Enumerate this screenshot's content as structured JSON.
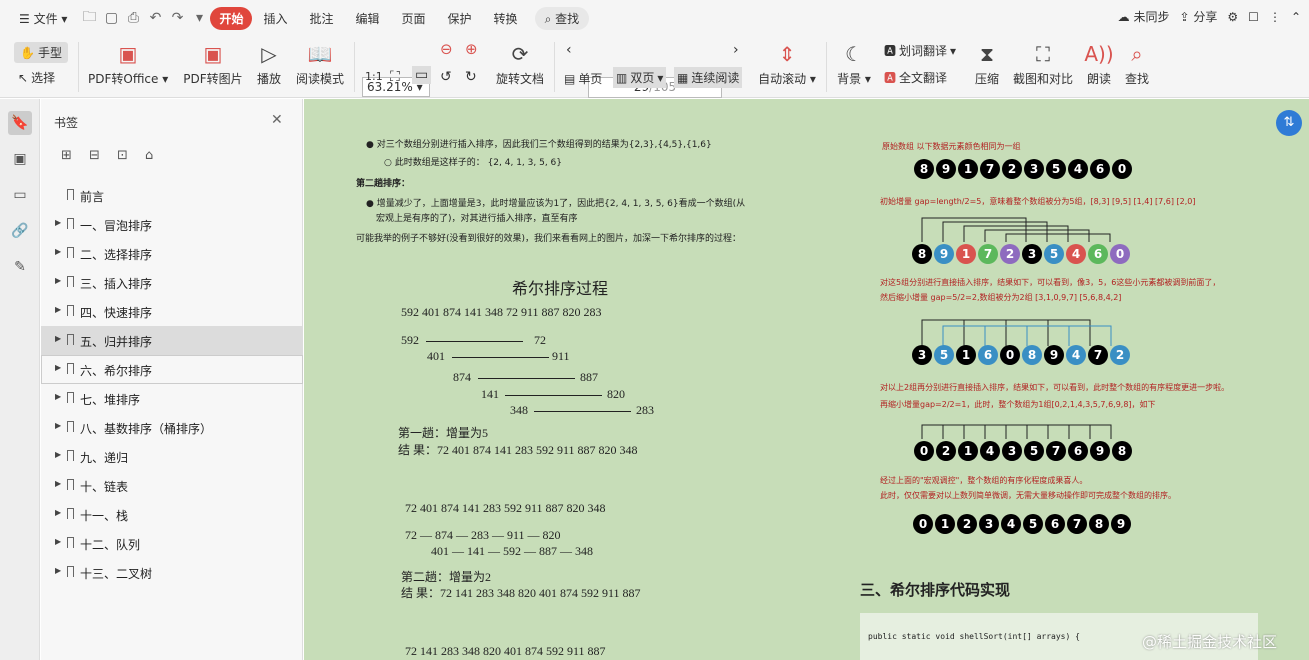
{
  "menu": {
    "hamburger": "☰",
    "file": "文件",
    "start": "开始",
    "insert": "插入",
    "comment": "批注",
    "edit": "编辑",
    "page": "页面",
    "protect": "保护",
    "convert": "转换",
    "search": "查找",
    "unsync": "未同步",
    "share": "分享"
  },
  "toolbar": {
    "hand": "手型",
    "select": "选择",
    "pdf_office": "PDF转Office",
    "pdf_image": "PDF转图片",
    "play": "播放",
    "read_mode": "阅读模式",
    "zoom": "63.21%",
    "rotate_doc": "旋转文档",
    "page_current": "29",
    "page_total": "/105",
    "single": "单页",
    "double": "双页",
    "continuous": "连续阅读",
    "auto_scroll": "自动滚动",
    "background": "背景",
    "word_translate": "划词翻译",
    "full_translate": "全文翻译",
    "compress": "压缩",
    "screenshot_compare": "截图和对比",
    "read_aloud": "朗读",
    "find": "查找"
  },
  "panel": {
    "title": "书签",
    "items": [
      {
        "label": "前言",
        "expand": false
      },
      {
        "label": "一、冒泡排序",
        "expand": true
      },
      {
        "label": "二、选择排序",
        "expand": true
      },
      {
        "label": "三、插入排序",
        "expand": true
      },
      {
        "label": "四、快速排序",
        "expand": true
      },
      {
        "label": "五、归并排序",
        "expand": true
      },
      {
        "label": "六、希尔排序",
        "expand": true
      },
      {
        "label": "七、堆排序",
        "expand": true
      },
      {
        "label": "八、基数排序（桶排序）",
        "expand": true
      },
      {
        "label": "九、递归",
        "expand": true
      },
      {
        "label": "十、链表",
        "expand": true
      },
      {
        "label": "十一、栈",
        "expand": true
      },
      {
        "label": "十二、队列",
        "expand": true
      },
      {
        "label": "十三、二叉树",
        "expand": true
      }
    ]
  },
  "doc": {
    "p1": "对三个数组分别进行插入排序，因此我们三个数组得到的结果为{2,3},{4,5},{1,6}",
    "p2": "此时数组是这样子的：  {2, 4, 1, 3, 5, 6}",
    "p3": "第二趟排序：",
    "p4": "增量减少了，上面增量是3，此时增量应该为1了，因此把{2, 4, 1, 3, 5, 6}看成一个数组(从",
    "p5": "宏观上是有序的了)，对其进行插入排序，直至有序",
    "p6": "可能我举的例子不够好(没看到很好的效果)，我们来看看网上的图片，加深一下希尔排序的过程：",
    "shell_title": "希尔排序过程",
    "seq0": "592  401  874  141  348  72  911  887  820  283",
    "g1": [
      "592",
      "72",
      "401",
      "911",
      "874",
      "887",
      "141",
      "820",
      "348",
      "283"
    ],
    "pass1_label": "第一趟：增量为5",
    "pass1_result": "结    果：72  401  874  141  283  592  911  887  820  348",
    "seq1": "72  401  874  141  283  592  911  887  820  348",
    "g2a": "72    —  874   —   283   —   911   —   820",
    "g2b": "401  —  141   —   592   —   887   —   348",
    "pass2_label": "第二趟：增量为2",
    "pass2_result": "结    果：72  141  283  348  820  401  874  592  911  887",
    "seq2": "72  141  283  348  820  401  874  592  911  887",
    "r_orig": "原始数组    以下数据元素颜色相同为一组",
    "r_init": "初始增量 gap=length/2=5，意味着整个数组被分为5组，[8,3] [9,5] [1,4] [7,6] [2,0]",
    "r_a": "对这5组分别进行直接插入排序，结果如下，可以看到，像3，5，6这些小元素都被调到前面了，",
    "r_b": "然后缩小增量 gap=5/2=2,数组被分为2组 [3,1,0,9,7] [5,6,8,4,2]",
    "r_c": "对以上2组再分别进行直接插入排序，结果如下，可以看到，此时整个数组的有序程度更进一步啦。",
    "r_d": "再缩小增量gap=2/2=1，此时，整个数组为1组[0,2,1,4,3,5,7,6,9,8]，如下",
    "r_e": "经过上面的\"宏观调控\"，整个数组的有序化程度成果喜人。",
    "r_f": "此时，仅仅需要对以上数列简单微调，无需大量移动操作即可完成整个数组的排序。",
    "arr0": [
      "8",
      "9",
      "1",
      "7",
      "2",
      "3",
      "5",
      "4",
      "6",
      "0"
    ],
    "arr1": [
      "8",
      "9",
      "1",
      "7",
      "2",
      "3",
      "5",
      "4",
      "6",
      "0"
    ],
    "arr1_colors": [
      "#000",
      "#3a8fc4",
      "#d9534f",
      "#5cb85c",
      "#8e6bbf",
      "#000",
      "#3a8fc4",
      "#d9534f",
      "#5cb85c",
      "#8e6bbf"
    ],
    "arr2": [
      "3",
      "5",
      "1",
      "6",
      "0",
      "8",
      "9",
      "4",
      "7",
      "2"
    ],
    "arr2_colors": [
      "#000",
      "#3a8fc4",
      "#000",
      "#3a8fc4",
      "#000",
      "#3a8fc4",
      "#000",
      "#3a8fc4",
      "#000",
      "#3a8fc4"
    ],
    "arr3": [
      "0",
      "2",
      "1",
      "4",
      "3",
      "5",
      "7",
      "6",
      "9",
      "8"
    ],
    "arr4": [
      "0",
      "1",
      "2",
      "3",
      "4",
      "5",
      "6",
      "7",
      "8",
      "9"
    ],
    "section": "三、希尔排序代码实现",
    "code": "public static void shellSort(int[] arrays) {",
    "watermark": "@稀土掘金技术社区"
  }
}
